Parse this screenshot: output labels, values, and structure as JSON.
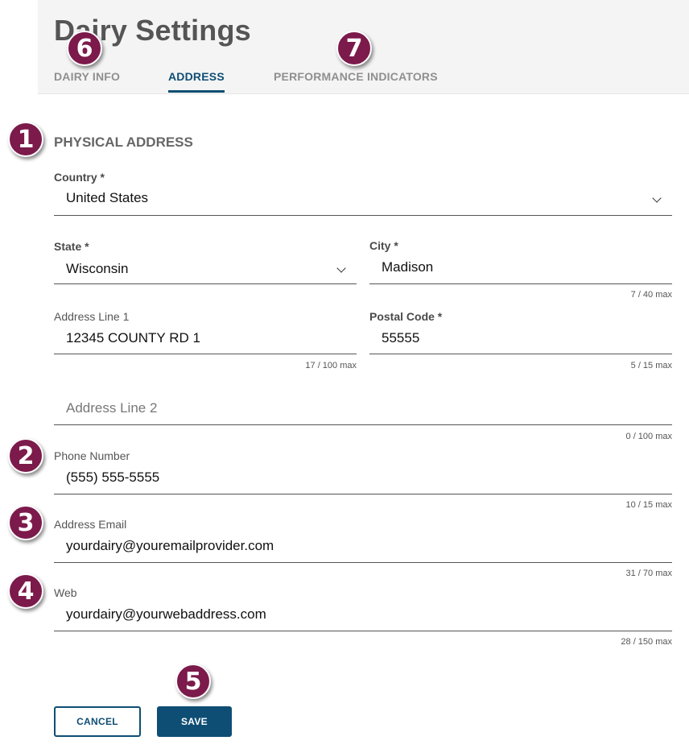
{
  "header": {
    "title": "Dairy Settings",
    "tabs": [
      {
        "label": "DAIRY INFO",
        "active": false
      },
      {
        "label": "ADDRESS",
        "active": true
      },
      {
        "label": "PERFORMANCE INDICATORS",
        "active": false
      }
    ]
  },
  "form": {
    "section_heading": "PHYSICAL ADDRESS",
    "country": {
      "label": "Country *",
      "value": "United States"
    },
    "state": {
      "label": "State *",
      "value": "Wisconsin"
    },
    "city": {
      "label": "City *",
      "value": "Madison",
      "counter": "7 / 40 max"
    },
    "address_line1": {
      "label": "Address Line 1",
      "value": "12345 COUNTY RD 1",
      "counter": "17 / 100 max"
    },
    "postal_code": {
      "label": "Postal Code *",
      "value": "55555",
      "counter": "5 / 15 max"
    },
    "address_line2": {
      "placeholder": "Address Line 2",
      "counter": "0 / 100 max"
    },
    "phone": {
      "label": "Phone Number",
      "value": "(555) 555-5555",
      "counter": "10 / 15 max"
    },
    "email": {
      "label": "Address Email",
      "value": "yourdairy@youremailprovider.com",
      "counter": "31 / 70 max"
    },
    "web": {
      "label": "Web",
      "value": "yourdairy@yourwebaddress.com",
      "counter": "28 / 150 max"
    }
  },
  "actions": {
    "cancel_label": "CANCEL",
    "save_label": "SAVE"
  },
  "markers": [
    "1",
    "2",
    "3",
    "4",
    "5",
    "6",
    "7"
  ],
  "colors": {
    "accent": "#0e4e74",
    "marker": "#7b1a4b"
  }
}
